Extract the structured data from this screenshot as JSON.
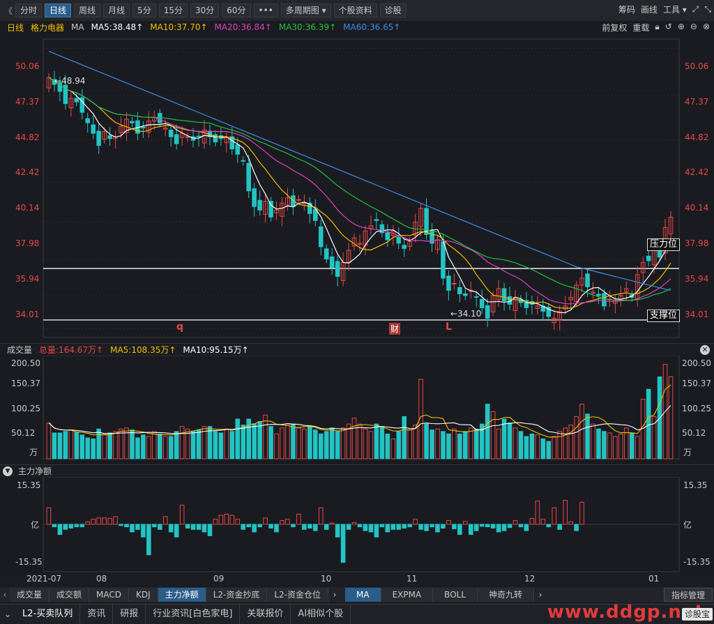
{
  "toolbar": {
    "back_glyph": "《",
    "buttons": [
      "分时",
      "日线",
      "周线",
      "月线",
      "5分",
      "15分",
      "30分",
      "60分",
      "•••",
      "多周期图 ▾",
      "个股资料",
      "诊股"
    ],
    "active": "日线",
    "right_items": [
      "筹码",
      "画线",
      "工具 ▾"
    ]
  },
  "legend": {
    "period": "日线",
    "stock_name": "格力电器",
    "ma_label": "MA",
    "ma5": "MA5:38.48↑",
    "ma10": "MA10:37.70↑",
    "ma20": "MA20:36.84↑",
    "ma30": "MA30:36.39↑",
    "ma60": "MA60:36.65↑",
    "right_items": [
      "前复权",
      "重载"
    ],
    "colors": {
      "ma5": "#ffffff",
      "ma10": "#f0c000",
      "ma20": "#e040c0",
      "ma30": "#20c040",
      "ma60": "#3a8ee6",
      "up": "#e84848",
      "down": "#22c4c4"
    }
  },
  "price_axis": {
    "ticks": [
      "50.06",
      "47.37",
      "44.82",
      "42.42",
      "40.14",
      "37.98",
      "35.94",
      "34.01"
    ],
    "high_marker": "←48.94",
    "low_marker": "←34.10",
    "resistance_label": "压力位",
    "support_label": "支撑位",
    "event_markers": [
      "q",
      "财",
      "L"
    ]
  },
  "volume": {
    "title": "成交量",
    "total": "总量:164.67万↑",
    "ma5": "MA5:108.35万↑",
    "ma10": "MA10:95.15万↑",
    "ticks": [
      "200.50",
      "150.37",
      "100.25",
      "50.12"
    ],
    "unit": "万"
  },
  "flow": {
    "title": "主力净额",
    "ticks_top": "15.35",
    "ticks_unit": "亿",
    "ticks_bottom": "-15.35"
  },
  "date_axis": [
    "2021-07",
    "08",
    "09",
    "10",
    "11",
    "12",
    "01"
  ],
  "indicator_tabs": [
    "成交量",
    "成交额",
    "MACD",
    "KDJ",
    "主力净额",
    "L2-资金抄底",
    "L2-资金仓位"
  ],
  "indicator_active": "主力净额",
  "overlay_tabs": [
    "MA",
    "EXPMA",
    "BOLL",
    "神奇九转"
  ],
  "overlay_active": "MA",
  "indicator_manage": "指标管理",
  "bottom_tabs": [
    "L2-买卖队列",
    "资讯",
    "研报",
    "行业资讯[白色家电]",
    "关联报价",
    "AI相似个股"
  ],
  "watermark": "www.ddgp.net",
  "zhengu": "诊股宝",
  "chart_data": {
    "type": "candlestick",
    "closes": [
      48.4,
      48.0,
      47.6,
      46.9,
      47.2,
      47.0,
      46.4,
      45.8,
      45.2,
      44.5,
      45.3,
      44.9,
      45.0,
      45.6,
      46.0,
      45.8,
      45.2,
      45.5,
      45.9,
      46.1,
      45.8,
      45.5,
      45.0,
      44.6,
      45.2,
      45.0,
      44.8,
      45.0,
      45.4,
      45.0,
      44.7,
      44.9,
      45.0,
      44.3,
      44.0,
      43.6,
      41.9,
      41.0,
      40.8,
      41.3,
      40.4,
      40.8,
      41.2,
      41.5,
      41.0,
      41.4,
      41.2,
      40.6,
      40.2,
      38.7,
      38.0,
      37.5,
      37.0,
      37.8,
      38.5,
      39.2,
      38.9,
      39.6,
      39.9,
      40.2,
      39.5,
      39.1,
      39.6,
      38.9,
      38.6,
      39.0,
      40.1,
      40.9,
      39.4,
      38.9,
      39.1,
      36.9,
      36.2,
      36.6,
      36.0,
      35.9,
      36.2,
      35.8,
      35.2,
      34.6,
      35.9,
      36.3,
      35.6,
      35.4,
      35.8,
      35.5,
      35.2,
      35.4,
      35.3,
      35.0,
      34.7,
      34.6,
      35.0,
      35.3,
      35.8,
      36.5,
      36.9,
      36.4,
      36.1,
      35.9,
      35.3,
      35.7,
      35.6,
      35.9,
      36.3,
      35.8,
      37.1,
      37.8,
      37.9,
      38.6,
      38.1,
      39.8,
      40.4
    ],
    "volume_values": [
      72,
      52,
      52,
      55,
      58,
      53,
      48,
      42,
      40,
      60,
      50,
      52,
      55,
      60,
      62,
      58,
      42,
      48,
      45,
      55,
      50,
      45,
      45,
      55,
      65,
      60,
      55,
      58,
      65,
      65,
      55,
      52,
      60,
      55,
      80,
      68,
      80,
      70,
      75,
      88,
      65,
      50,
      62,
      70,
      70,
      62,
      60,
      65,
      58,
      50,
      55,
      62,
      55,
      62,
      70,
      82,
      70,
      60,
      55,
      70,
      65,
      50,
      40,
      55,
      85,
      58,
      68,
      160,
      70,
      58,
      60,
      55,
      50,
      60,
      50,
      55,
      62,
      60,
      70,
      110,
      95,
      60,
      80,
      72,
      62,
      55,
      45,
      50,
      48,
      40,
      35,
      45,
      55,
      62,
      68,
      85,
      110,
      90,
      70,
      60,
      55,
      52,
      45,
      50,
      62,
      52,
      45,
      120,
      140,
      85,
      165,
      190,
      165
    ],
    "flow_values": [
      6.5,
      -1,
      -4,
      -2,
      -1.5,
      -1,
      -1,
      1,
      2,
      2.5,
      2.5,
      2.3,
      3,
      -0.5,
      -1,
      -3,
      -2,
      -5,
      -12,
      -1,
      -2,
      3,
      -3,
      -5,
      7.5,
      -1.5,
      -2,
      -2,
      -3,
      -4.5,
      2,
      3.5,
      4,
      3.5,
      2,
      -2,
      -1,
      -3,
      -1,
      2.5,
      -1.5,
      -3,
      1.5,
      2,
      -1,
      4,
      -2,
      -1.5,
      -2.5,
      6.5,
      -2,
      0.5,
      -5,
      -15,
      -2,
      0.7,
      -1,
      -2.5,
      -3,
      -5,
      -1,
      -3,
      -2,
      -2,
      -1.5,
      -1,
      2,
      -2,
      -2.5,
      -1,
      -3,
      -1.5,
      1.5,
      -1.8,
      -4,
      1.2,
      -4,
      -2.5,
      -0.8,
      -1,
      -1.5,
      -3,
      -2.5,
      -1.3,
      1.5,
      -1,
      -2.5,
      2.3,
      9.2,
      2,
      -1,
      6.5,
      -2,
      9.4,
      1,
      -2.5,
      8.7
    ]
  }
}
